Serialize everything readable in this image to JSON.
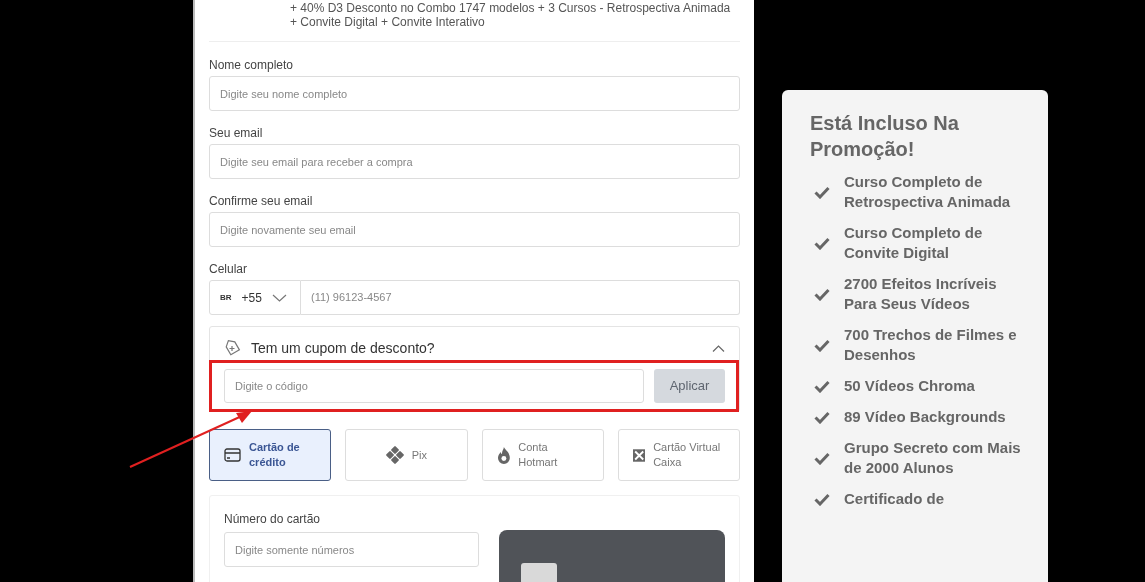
{
  "order_summary": {
    "description": "+ 40% D3 Desconto no Combo 1747 modelos + 3 Cursos - Retrospectiva Animada + Convite Digital + Convite Interativo"
  },
  "form": {
    "fields": [
      {
        "label": "Nome completo",
        "placeholder": "Digite seu nome completo"
      },
      {
        "label": "Seu email",
        "placeholder": "Digite seu email para receber a compra"
      },
      {
        "label": "Confirme seu email",
        "placeholder": "Digite novamente seu email"
      }
    ],
    "phone": {
      "label": "Celular",
      "country": "BR",
      "code": "+55",
      "placeholder": "(11) 96123-4567"
    }
  },
  "coupon": {
    "title": "Tem um cupom de desconto?",
    "expanded": true,
    "placeholder": "Digite o código",
    "button": "Aplicar",
    "disabled": true
  },
  "payment_methods": [
    {
      "kind": "card",
      "label": "Cartão de crédito",
      "selected": true
    },
    {
      "kind": "pix",
      "label": "Pix",
      "selected": false
    },
    {
      "kind": "hotmart",
      "label": "Conta Hotmart",
      "selected": false
    },
    {
      "kind": "caixa",
      "label": "Cartão Virtual Caixa",
      "selected": false
    }
  ],
  "card_form": {
    "label": "Número do cartão",
    "placeholder": "Digite somente números"
  },
  "promo": {
    "title": "Está Incluso Na Promoção!",
    "items": [
      "Curso Completo de Retrospectiva Animada",
      "Curso Completo de Convite Digital",
      "2700 Efeitos Incríveis Para Seus Vídeos",
      "700 Trechos de Filmes e Desenhos",
      "50 Vídeos Chroma",
      "89 Vídeo Backgrounds",
      "Grupo Secreto com Mais de 2000 Alunos",
      "Certificado de"
    ]
  }
}
